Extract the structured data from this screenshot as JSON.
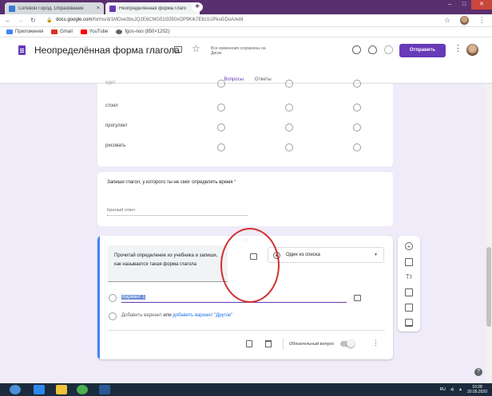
{
  "browser": {
    "tabs": [
      {
        "title": "Сетевой Город. Образование",
        "favicon_color": "#3a7bd5"
      },
      {
        "title": "Неопределённая форма глаго",
        "favicon_color": "#673ab7"
      }
    ],
    "new_tab": "+",
    "close_glyph": "×",
    "url_secure": "docs.google.com",
    "url_path": "/forms/d/1MOxe3bsJQ2E6CMG51l3350xOP9KIk7E8z1UPkuGDoA/edit",
    "bookmarks": [
      {
        "label": "Приложения",
        "icon": "apps-icon",
        "color": "#4285f4"
      },
      {
        "label": "Gmail",
        "icon": "gmail-icon",
        "color": "#d93025"
      },
      {
        "label": "YouTube",
        "icon": "youtube-icon",
        "color": "#ff0000"
      },
      {
        "label": "fgos-noo (850×1202)",
        "icon": "globe-icon",
        "color": "#5f6368"
      }
    ]
  },
  "form_header": {
    "title": "Неопределённая форма глагола",
    "saved_status": "Все изменения сохранены на Диске",
    "send_label": "Отправить",
    "accent": "#673ab7",
    "tabs": [
      {
        "label": "Вопросы",
        "active": true
      },
      {
        "label": "Ответы",
        "active": false
      }
    ]
  },
  "grid_card": {
    "rows": [
      {
        "label": "едет"
      },
      {
        "label": "стоял"
      },
      {
        "label": "прогуляет"
      },
      {
        "label": "рисовать"
      }
    ],
    "columns_count": 3
  },
  "text_question": {
    "text": "Запиши глагол, у которого ты не смог определить время",
    "required_mark": "*",
    "placeholder": "Краткий ответ"
  },
  "choice_question": {
    "drag_handle": "∷∷",
    "text": "Прочитай определение из учебника и запиши, как называется такая форма глагола",
    "type": "Один из списка",
    "caret": "▾",
    "option_1": "Вариант 1",
    "add_option": "Добавить вариант",
    "or": "или",
    "add_other": "добавить вариант \"Другое\"",
    "required_label": "Обязательный вопрос",
    "required_on": false,
    "highlight_color": "#d32f2f"
  },
  "side_toolbar": {
    "add": "+",
    "title": "Тт"
  },
  "system": {
    "lang": "RU",
    "time": "10:28",
    "date": "20.05.2020"
  }
}
